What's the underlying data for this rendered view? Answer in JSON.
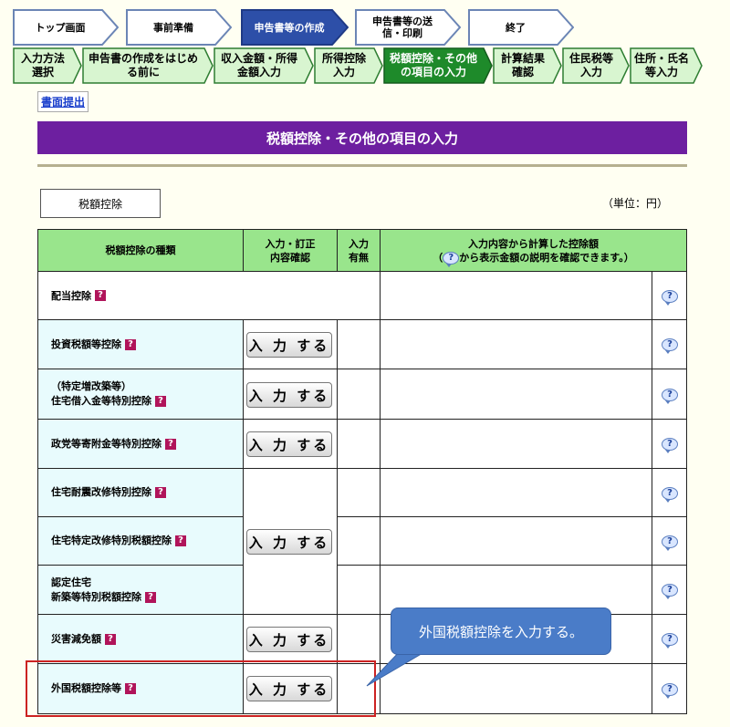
{
  "steps": [
    "トップ画面",
    "事前準備",
    "申告書等の作成",
    "申告書等の送信・印刷",
    "終了"
  ],
  "substeps": [
    "入力方法選択",
    "申告書の作成をはじめる前に",
    "収入金額・所得金額入力",
    "所得控除入力",
    "税額控除・その他の項目の入力",
    "計算結果確認",
    "住民税等入力",
    "住所・氏名等入力"
  ],
  "submit_link": "書面提出",
  "page_title": "税額控除・その他の項目の入力",
  "tab_label": "税額控除",
  "unit_label": "（単位：円）",
  "table": {
    "col_type": "税額控除の種類",
    "col_entry": "入力・訂正\n内容確認",
    "col_done": "入力\n有無",
    "col_amount_line1": "入力内容から計算した控除額",
    "col_amount_line2_pre": "（",
    "col_amount_line2_post": "から表示金額の説明を確認できます。）",
    "rows": [
      {
        "name": "配当控除"
      },
      {
        "name": "投資税額等控除"
      },
      {
        "name": "（特定増改築等）\n住宅借入金等特別控除"
      },
      {
        "name": "政党等寄附金等特別控除"
      },
      {
        "name": "住宅耐震改修特別控除"
      },
      {
        "name": "住宅特定改修特別税額控除"
      },
      {
        "name": "認定住宅\n新築等特別税額控除"
      },
      {
        "name": "災害減免額"
      },
      {
        "name": "外国税額控除等"
      }
    ]
  },
  "button_label": "入 力 する",
  "callout": "外国税額控除を入力する。",
  "colors": {
    "title_bg": "#6d1fa0",
    "header_bg": "#99e58c",
    "name_bg": "#e8fbfd",
    "highlight": "#cc2222",
    "callout": "#4a7cc8"
  }
}
